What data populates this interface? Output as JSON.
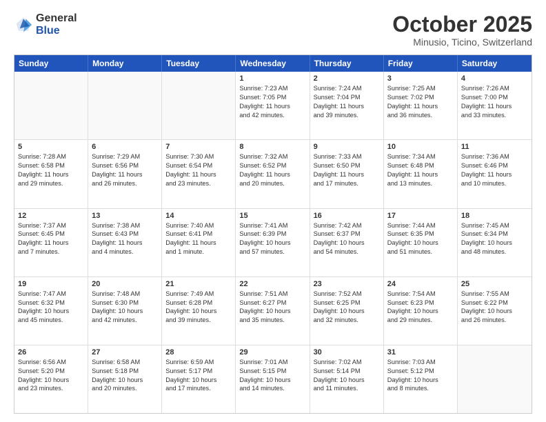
{
  "logo": {
    "general": "General",
    "blue": "Blue"
  },
  "header": {
    "month": "October 2025",
    "location": "Minusio, Ticino, Switzerland"
  },
  "days": [
    "Sunday",
    "Monday",
    "Tuesday",
    "Wednesday",
    "Thursday",
    "Friday",
    "Saturday"
  ],
  "rows": [
    [
      {
        "day": "",
        "lines": []
      },
      {
        "day": "",
        "lines": []
      },
      {
        "day": "",
        "lines": []
      },
      {
        "day": "1",
        "lines": [
          "Sunrise: 7:23 AM",
          "Sunset: 7:05 PM",
          "Daylight: 11 hours",
          "and 42 minutes."
        ]
      },
      {
        "day": "2",
        "lines": [
          "Sunrise: 7:24 AM",
          "Sunset: 7:04 PM",
          "Daylight: 11 hours",
          "and 39 minutes."
        ]
      },
      {
        "day": "3",
        "lines": [
          "Sunrise: 7:25 AM",
          "Sunset: 7:02 PM",
          "Daylight: 11 hours",
          "and 36 minutes."
        ]
      },
      {
        "day": "4",
        "lines": [
          "Sunrise: 7:26 AM",
          "Sunset: 7:00 PM",
          "Daylight: 11 hours",
          "and 33 minutes."
        ]
      }
    ],
    [
      {
        "day": "5",
        "lines": [
          "Sunrise: 7:28 AM",
          "Sunset: 6:58 PM",
          "Daylight: 11 hours",
          "and 29 minutes."
        ]
      },
      {
        "day": "6",
        "lines": [
          "Sunrise: 7:29 AM",
          "Sunset: 6:56 PM",
          "Daylight: 11 hours",
          "and 26 minutes."
        ]
      },
      {
        "day": "7",
        "lines": [
          "Sunrise: 7:30 AM",
          "Sunset: 6:54 PM",
          "Daylight: 11 hours",
          "and 23 minutes."
        ]
      },
      {
        "day": "8",
        "lines": [
          "Sunrise: 7:32 AM",
          "Sunset: 6:52 PM",
          "Daylight: 11 hours",
          "and 20 minutes."
        ]
      },
      {
        "day": "9",
        "lines": [
          "Sunrise: 7:33 AM",
          "Sunset: 6:50 PM",
          "Daylight: 11 hours",
          "and 17 minutes."
        ]
      },
      {
        "day": "10",
        "lines": [
          "Sunrise: 7:34 AM",
          "Sunset: 6:48 PM",
          "Daylight: 11 hours",
          "and 13 minutes."
        ]
      },
      {
        "day": "11",
        "lines": [
          "Sunrise: 7:36 AM",
          "Sunset: 6:46 PM",
          "Daylight: 11 hours",
          "and 10 minutes."
        ]
      }
    ],
    [
      {
        "day": "12",
        "lines": [
          "Sunrise: 7:37 AM",
          "Sunset: 6:45 PM",
          "Daylight: 11 hours",
          "and 7 minutes."
        ]
      },
      {
        "day": "13",
        "lines": [
          "Sunrise: 7:38 AM",
          "Sunset: 6:43 PM",
          "Daylight: 11 hours",
          "and 4 minutes."
        ]
      },
      {
        "day": "14",
        "lines": [
          "Sunrise: 7:40 AM",
          "Sunset: 6:41 PM",
          "Daylight: 11 hours",
          "and 1 minute."
        ]
      },
      {
        "day": "15",
        "lines": [
          "Sunrise: 7:41 AM",
          "Sunset: 6:39 PM",
          "Daylight: 10 hours",
          "and 57 minutes."
        ]
      },
      {
        "day": "16",
        "lines": [
          "Sunrise: 7:42 AM",
          "Sunset: 6:37 PM",
          "Daylight: 10 hours",
          "and 54 minutes."
        ]
      },
      {
        "day": "17",
        "lines": [
          "Sunrise: 7:44 AM",
          "Sunset: 6:35 PM",
          "Daylight: 10 hours",
          "and 51 minutes."
        ]
      },
      {
        "day": "18",
        "lines": [
          "Sunrise: 7:45 AM",
          "Sunset: 6:34 PM",
          "Daylight: 10 hours",
          "and 48 minutes."
        ]
      }
    ],
    [
      {
        "day": "19",
        "lines": [
          "Sunrise: 7:47 AM",
          "Sunset: 6:32 PM",
          "Daylight: 10 hours",
          "and 45 minutes."
        ]
      },
      {
        "day": "20",
        "lines": [
          "Sunrise: 7:48 AM",
          "Sunset: 6:30 PM",
          "Daylight: 10 hours",
          "and 42 minutes."
        ]
      },
      {
        "day": "21",
        "lines": [
          "Sunrise: 7:49 AM",
          "Sunset: 6:28 PM",
          "Daylight: 10 hours",
          "and 39 minutes."
        ]
      },
      {
        "day": "22",
        "lines": [
          "Sunrise: 7:51 AM",
          "Sunset: 6:27 PM",
          "Daylight: 10 hours",
          "and 35 minutes."
        ]
      },
      {
        "day": "23",
        "lines": [
          "Sunrise: 7:52 AM",
          "Sunset: 6:25 PM",
          "Daylight: 10 hours",
          "and 32 minutes."
        ]
      },
      {
        "day": "24",
        "lines": [
          "Sunrise: 7:54 AM",
          "Sunset: 6:23 PM",
          "Daylight: 10 hours",
          "and 29 minutes."
        ]
      },
      {
        "day": "25",
        "lines": [
          "Sunrise: 7:55 AM",
          "Sunset: 6:22 PM",
          "Daylight: 10 hours",
          "and 26 minutes."
        ]
      }
    ],
    [
      {
        "day": "26",
        "lines": [
          "Sunrise: 6:56 AM",
          "Sunset: 5:20 PM",
          "Daylight: 10 hours",
          "and 23 minutes."
        ]
      },
      {
        "day": "27",
        "lines": [
          "Sunrise: 6:58 AM",
          "Sunset: 5:18 PM",
          "Daylight: 10 hours",
          "and 20 minutes."
        ]
      },
      {
        "day": "28",
        "lines": [
          "Sunrise: 6:59 AM",
          "Sunset: 5:17 PM",
          "Daylight: 10 hours",
          "and 17 minutes."
        ]
      },
      {
        "day": "29",
        "lines": [
          "Sunrise: 7:01 AM",
          "Sunset: 5:15 PM",
          "Daylight: 10 hours",
          "and 14 minutes."
        ]
      },
      {
        "day": "30",
        "lines": [
          "Sunrise: 7:02 AM",
          "Sunset: 5:14 PM",
          "Daylight: 10 hours",
          "and 11 minutes."
        ]
      },
      {
        "day": "31",
        "lines": [
          "Sunrise: 7:03 AM",
          "Sunset: 5:12 PM",
          "Daylight: 10 hours",
          "and 8 minutes."
        ]
      },
      {
        "day": "",
        "lines": []
      }
    ]
  ]
}
